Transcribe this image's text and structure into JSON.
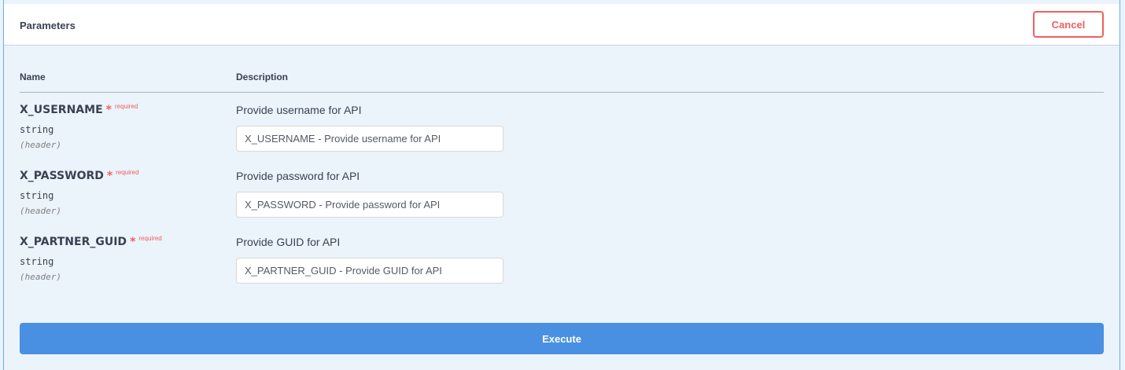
{
  "section": {
    "title": "Parameters",
    "cancel_label": "Cancel"
  },
  "columns": {
    "name": "Name",
    "description": "Description"
  },
  "parameters": [
    {
      "name": "X_USERNAME",
      "required_star": "*",
      "required_label": "required",
      "type": "string",
      "location": "(header)",
      "description": "Provide username for API",
      "placeholder": "X_USERNAME - Provide username for API",
      "value": ""
    },
    {
      "name": "X_PASSWORD",
      "required_star": "*",
      "required_label": "required",
      "type": "string",
      "location": "(header)",
      "description": "Provide password for API",
      "placeholder": "X_PASSWORD - Provide password for API",
      "value": ""
    },
    {
      "name": "X_PARTNER_GUID",
      "required_star": "*",
      "required_label": "required",
      "type": "string",
      "location": "(header)",
      "description": "Provide GUID for API",
      "placeholder": "X_PARTNER_GUID - Provide GUID for API",
      "value": ""
    }
  ],
  "execute_label": "Execute",
  "colors": {
    "panel_bg": "#ebf3fb",
    "accent_blue": "#4990e2",
    "border_blue": "#61affe",
    "danger_red": "#f06060"
  }
}
